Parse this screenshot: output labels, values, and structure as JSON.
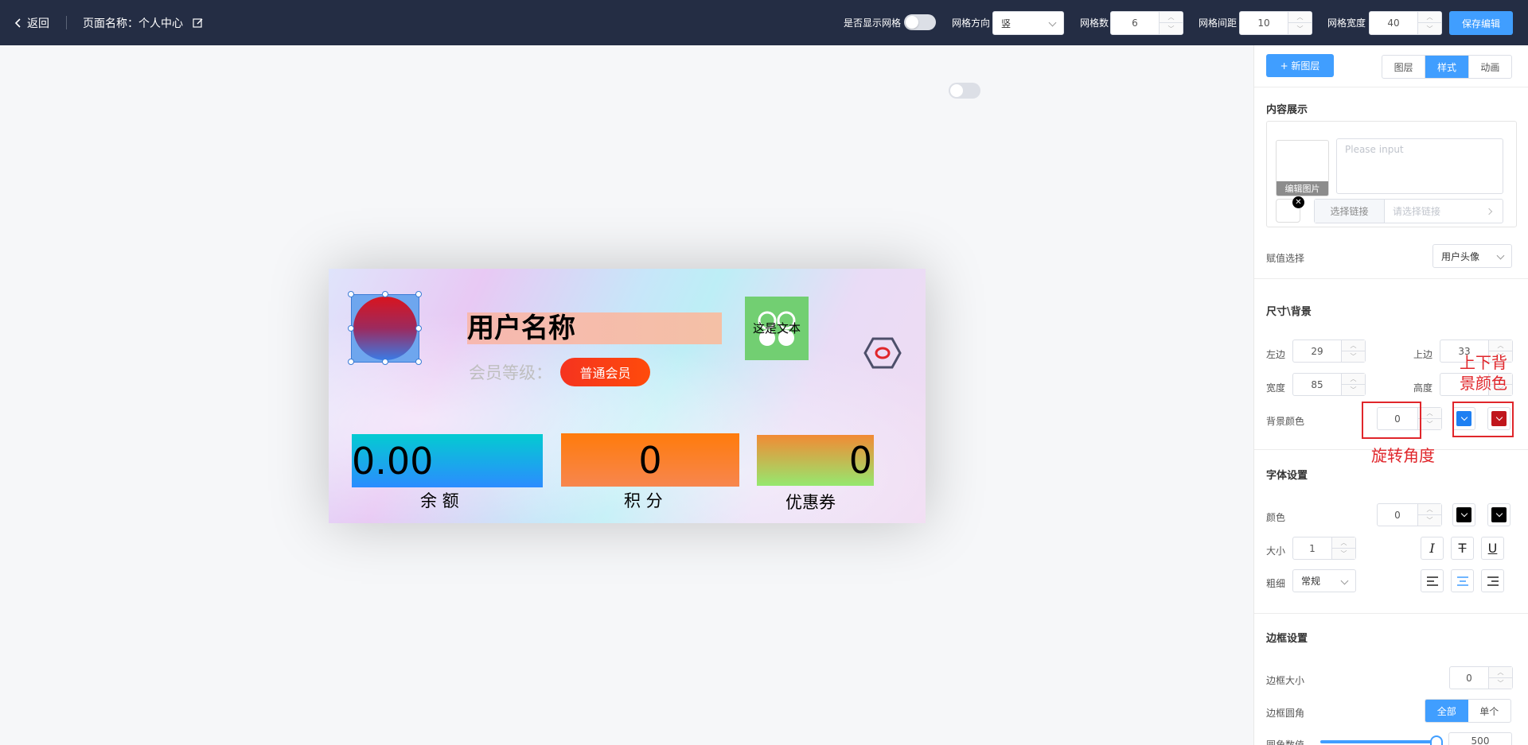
{
  "topbar": {
    "back_label": "返回",
    "page_name": "页面名称：个人中心",
    "show_grid_label": "是否显示网格",
    "grid_dir_label": "网格方向",
    "grid_dir_value": "竖",
    "grid_count_label": "网格数",
    "grid_count_value": "6",
    "grid_gap_label": "网格间距",
    "grid_gap_value": "10",
    "grid_width_label": "网格宽度",
    "grid_width_value": "40",
    "save_label": "保存编辑"
  },
  "card": {
    "username": "用户名称",
    "level_label": "会员等级：",
    "level_value": "普通会员",
    "text_block": "这是文本",
    "stats": [
      {
        "value": "0.00",
        "label": "余 额"
      },
      {
        "value": "0",
        "label": "积 分"
      },
      {
        "value": "0",
        "label": "优惠券"
      }
    ]
  },
  "panel": {
    "new_layer_label": "+ 新图层",
    "tabs": [
      {
        "label": "图层",
        "active": false
      },
      {
        "label": "样式",
        "active": true
      },
      {
        "label": "动画",
        "active": false
      }
    ],
    "content_section": {
      "title": "内容展示",
      "edit_image_label": "编辑图片",
      "textarea_placeholder": "Please input",
      "link_button": "选择链接",
      "link_placeholder": "请选择链接"
    },
    "assign": {
      "label": "赋值选择",
      "value": "用户头像"
    },
    "size_section": {
      "title": "尺寸\\背景",
      "left_label": "左边",
      "left_value": "29",
      "top_label": "上边",
      "top_value": "33",
      "width_label": "宽度",
      "width_value": "85",
      "height_label": "高度",
      "bg_label": "背景颜色",
      "rotation_value": "0",
      "bg_color_1": "#1e7ff2",
      "bg_color_2": "#c0161c"
    },
    "font_section": {
      "title": "字体设置",
      "color_label": "颜色",
      "color_rotation_value": "0",
      "size_label": "大小",
      "size_value": "1",
      "weight_label": "粗细",
      "weight_value": "常规",
      "italic_icon": "I",
      "strike_icon": "T",
      "underline_icon": "U"
    },
    "border_section": {
      "title": "边框设置",
      "size_label": "边框大小",
      "size_value": "0",
      "radius_label": "边框圆角",
      "radius_options": [
        {
          "label": "全部",
          "active": true
        },
        {
          "label": "单个",
          "active": false
        }
      ],
      "radius_value_label": "圆角数值",
      "radius_value": "500"
    }
  },
  "annotations": {
    "bg_colors": "上下背景颜色",
    "rotation": "旋转角度"
  },
  "colors": {
    "accent": "#409eff",
    "topbar": "#242d44",
    "annotation": "#e0262b"
  }
}
